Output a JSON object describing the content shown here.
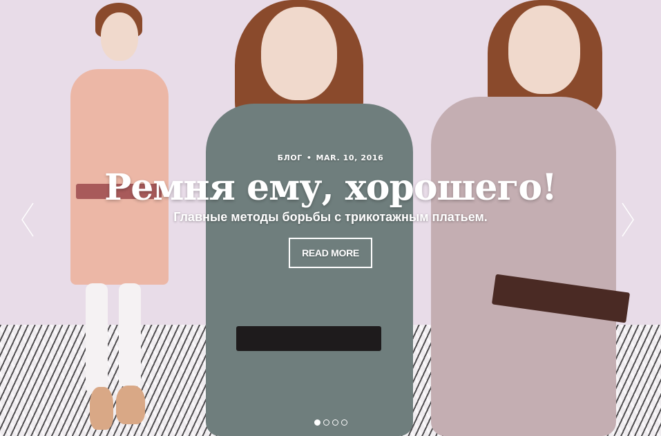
{
  "slide": {
    "category": "БЛОГ",
    "separator": "•",
    "date": "MAR. 10, 2016",
    "title": "Ремня ему, хорошего!",
    "subtitle": "Главные методы борьбы с трикотажным платьем.",
    "button_label": "READ MORE"
  },
  "controls": {
    "prev_icon": "chevron-left-icon",
    "next_icon": "chevron-right-icon",
    "slide_count": 4,
    "active_slide": 1
  },
  "colors": {
    "background": "#e8dce8",
    "dress_left": "#ecb7a6",
    "dress_center": "#6f7e7d",
    "dress_right": "#c4aeb2",
    "hair": "#8a4a2c"
  }
}
